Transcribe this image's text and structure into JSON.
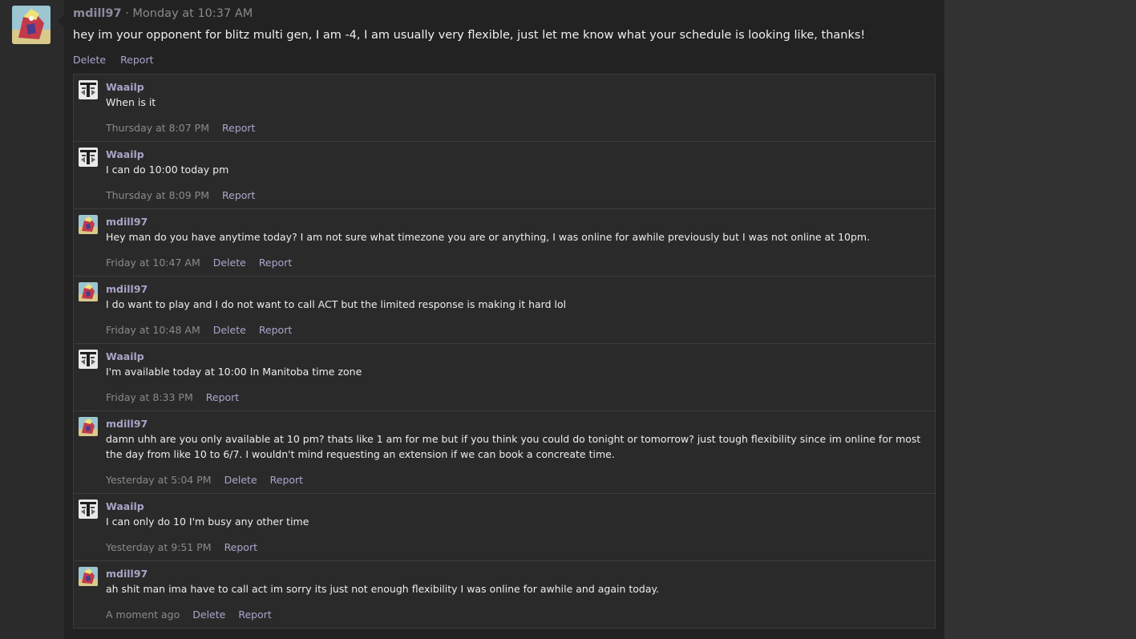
{
  "post": {
    "author": "mdill97",
    "separator": "·",
    "time": "Monday at 10:37 AM",
    "body": "hey im your opponent for blitz multi gen, I am -4, I am usually very flexible, just let me know what your schedule is looking like, thanks!",
    "actions": {
      "delete": "Delete",
      "report": "Report"
    }
  },
  "comments": [
    {
      "author": "Waailp",
      "avatar": "waailp",
      "text": "When is it",
      "time": "Thursday at 8:07 PM",
      "delete": "",
      "report": "Report"
    },
    {
      "author": "Waailp",
      "avatar": "waailp",
      "text": "I can do 10:00 today pm",
      "time": "Thursday at 8:09 PM",
      "delete": "",
      "report": "Report"
    },
    {
      "author": "mdill97",
      "avatar": "mdill97",
      "text": "Hey man do you have anytime today? I am not sure what timezone you are or anything, I was online for awhile previously but I was not online at 10pm.",
      "time": "Friday at 10:47 AM",
      "delete": "Delete",
      "report": "Report"
    },
    {
      "author": "mdill97",
      "avatar": "mdill97",
      "text": "I do want to play and I do not want to call ACT but the limited response is making it hard lol",
      "time": "Friday at 10:48 AM",
      "delete": "Delete",
      "report": "Report"
    },
    {
      "author": "Waailp",
      "avatar": "waailp",
      "text": "I'm available today at 10:00 In Manitoba time zone",
      "time": "Friday at 8:33 PM",
      "delete": "",
      "report": "Report"
    },
    {
      "author": "mdill97",
      "avatar": "mdill97",
      "text": "damn uhh are you only available at 10 pm? thats like 1 am for me but if you think you could do tonight or tomorrow? just tough flexibility since im online for most the day from like 10 to 6/7. I wouldn't mind requesting an extension if we can book a concreate time.",
      "time": "Yesterday at 5:04 PM",
      "delete": "Delete",
      "report": "Report"
    },
    {
      "author": "Waailp",
      "avatar": "waailp",
      "text": "I can only do 10 I'm busy any other time",
      "time": "Yesterday at 9:51 PM",
      "delete": "",
      "report": "Report"
    },
    {
      "author": "mdill97",
      "avatar": "mdill97",
      "text": "ah shit man ima have to call act im sorry its just not enough flexibility I was online for awhile and again today.",
      "time": "A moment ago",
      "delete": "Delete",
      "report": "Report"
    }
  ]
}
